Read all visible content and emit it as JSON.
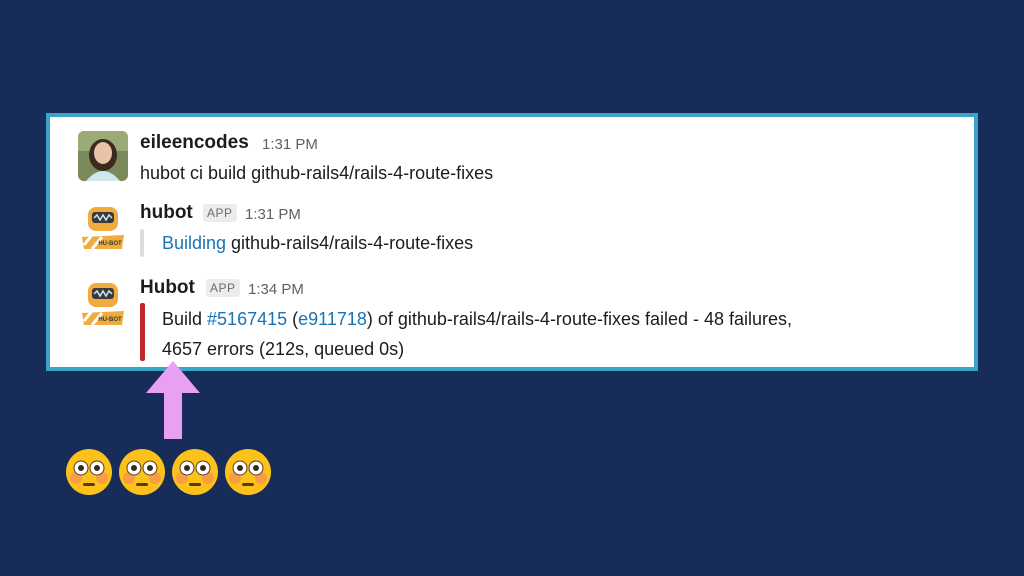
{
  "messages": [
    {
      "author": "eileencodes",
      "time": "1:31 PM",
      "text": "hubot ci build github-rails4/rails-4-route-fixes"
    },
    {
      "author": "hubot",
      "badge": "APP",
      "time": "1:31 PM",
      "link_text": "Building",
      "rest_text": " github-rails4/rails-4-route-fixes"
    },
    {
      "author": "Hubot",
      "badge": "APP",
      "time": "1:34 PM",
      "line1_pre": "Build ",
      "build_link": "#5167415",
      "paren_open": " (",
      "commit_link": "e911718",
      "line1_post": ") of github-rails4/rails-4-route-fixes failed - 48 failures,",
      "line2": "4657 errors (212s, queued 0s)",
      "status_color": "#c0282c"
    }
  ],
  "avatar_hubot_label": "HU-BOT",
  "emojis": [
    "flushed-face",
    "flushed-face",
    "flushed-face",
    "flushed-face"
  ],
  "colors": {
    "background": "#172c58",
    "panel_border": "#3aa3c8",
    "link": "#1a73b5",
    "arrow": "#e8a0f0"
  }
}
